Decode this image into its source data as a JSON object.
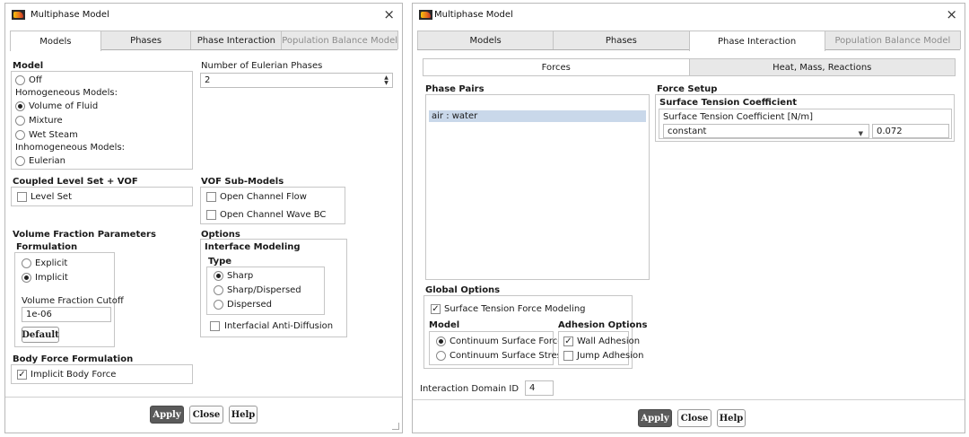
{
  "win1": {
    "title": "Multiphase Model",
    "close": "×",
    "tabs": [
      "Models",
      "Phases",
      "Phase Interaction",
      "Population Balance Model"
    ],
    "model": {
      "heading": "Model",
      "off": "Off",
      "homogeneous_heading": "Homogeneous Models:",
      "vof": "Volume of Fluid",
      "mixture": "Mixture",
      "wet_steam": "Wet Steam",
      "inhomogeneous_heading": "Inhomogeneous Models:",
      "eulerian": "Eulerian"
    },
    "eulerian_phases": {
      "label": "Number of Eulerian Phases",
      "value": "2",
      "up": "▲",
      "down": "▼"
    },
    "coupled": {
      "heading": "Coupled Level Set + VOF",
      "level_set": "Level Set"
    },
    "vof_sub": {
      "heading": "VOF Sub-Models",
      "open_channel": "Open Channel Flow",
      "open_channel_wave": "Open Channel Wave BC"
    },
    "vfp": {
      "heading": "Volume Fraction Parameters",
      "formulation": "Formulation",
      "explicit": "Explicit",
      "implicit": "Implicit",
      "cutoff_label": "Volume Fraction Cutoff",
      "cutoff_value": "1e-06",
      "default_btn": "Default"
    },
    "options": {
      "heading": "Options",
      "interface_modeling": "Interface Modeling",
      "type": "Type",
      "sharp": "Sharp",
      "sharp_dispersed": "Sharp/Dispersed",
      "dispersed": "Dispersed",
      "anti_diffusion": "Interfacial Anti-Diffusion"
    },
    "body_force": {
      "heading": "Body Force Formulation",
      "implicit_body_force": "Implicit Body Force"
    },
    "buttons": {
      "apply": "Apply",
      "close": "Close",
      "help": "Help"
    },
    "checkmark": "✓"
  },
  "win2": {
    "title": "Multiphase Model",
    "close": "×",
    "tabs": [
      "Models",
      "Phases",
      "Phase Interaction",
      "Population Balance Model"
    ],
    "subtabs": [
      "Forces",
      "Heat, Mass, Reactions"
    ],
    "phase_pairs": {
      "heading": "Phase Pairs",
      "items": [
        "air : water"
      ]
    },
    "force_setup": {
      "heading": "Force Setup",
      "stc_heading": "Surface Tension Coefficient",
      "stc_label": "Surface Tension Coefficient [N/m]",
      "method": "constant",
      "value": "0.072",
      "arrow": "▼"
    },
    "global_options": {
      "heading": "Global Options",
      "stfm": "Surface Tension Force Modeling",
      "model_heading": "Model",
      "csf": "Continuum Surface Force",
      "css": "Continuum Surface Stress",
      "adhesion_heading": "Adhesion Options",
      "wall_adhesion": "Wall Adhesion",
      "jump_adhesion": "Jump Adhesion"
    },
    "interaction_domain": {
      "label": "Interaction Domain ID",
      "value": "4"
    },
    "buttons": {
      "apply": "Apply",
      "close": "Close",
      "help": "Help"
    },
    "checkmark": "✓"
  }
}
